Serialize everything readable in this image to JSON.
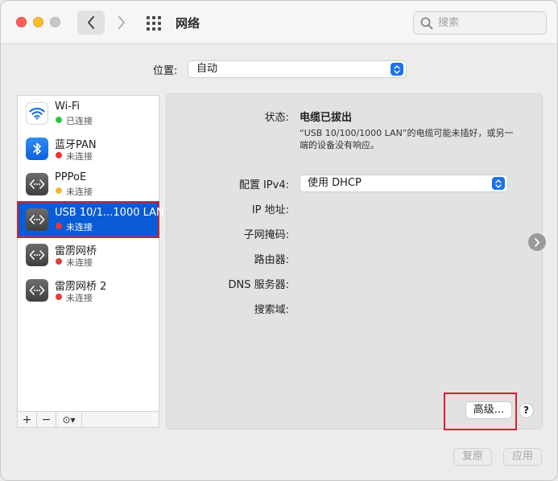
{
  "window": {
    "title": "网络"
  },
  "search": {
    "placeholder": "搜索"
  },
  "location": {
    "label": "位置:",
    "value": "自动"
  },
  "services": [
    {
      "name": "Wi-Fi",
      "status": "已连接",
      "status_color": "#28c940",
      "icon": "wifi-icon"
    },
    {
      "name": "蓝牙PAN",
      "status": "未连接",
      "status_color": "#e5393c",
      "icon": "bluetooth-icon"
    },
    {
      "name": "PPPoE",
      "status": "未连接",
      "status_color": "#f5b82e",
      "icon": "ethernet-icon"
    },
    {
      "name": "USB 10/1...1000 LAN",
      "status": "未连接",
      "status_color": "#e5393c",
      "icon": "ethernet-icon",
      "selected": true
    },
    {
      "name": "雷雳网桥",
      "status": "未连接",
      "status_color": "#e5393c",
      "icon": "ethernet-icon"
    },
    {
      "name": "雷雳网桥 2",
      "status": "未连接",
      "status_color": "#e5393c",
      "icon": "ethernet-icon"
    }
  ],
  "sidebar_buttons": {
    "add": "+",
    "remove": "−",
    "more": "⊙▾"
  },
  "detail": {
    "status_label": "状态:",
    "status_value": "电缆已拔出",
    "status_desc": "“USB 10/100/1000 LAN”的电缆可能未插好，或另一端的设备没有响应。",
    "ipv4_label": "配置 IPv4:",
    "ipv4_value": "使用 DHCP",
    "ip_label": "IP 地址:",
    "subnet_label": "子网掩码:",
    "router_label": "路由器:",
    "dns_label": "DNS 服务器:",
    "search_domain_label": "搜索域:",
    "advanced_label": "高级...",
    "help_label": "?"
  },
  "footer": {
    "revert": "复原",
    "apply": "应用"
  },
  "colors": {
    "accent": "#0a5bd6",
    "highlight": "#d2232a"
  }
}
